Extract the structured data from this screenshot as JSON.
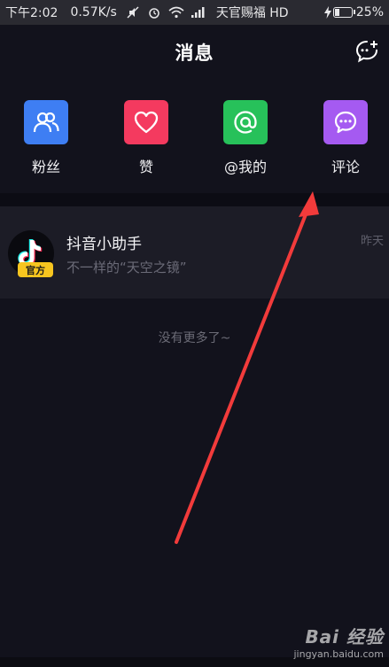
{
  "status_bar": {
    "time": "下午2:02",
    "net_speed": "0.57K/s",
    "carrier": "天官赐福 HD",
    "battery": "25%",
    "battery_level": 0.25
  },
  "header": {
    "title": "消息",
    "chat_icon": "add-chat-bubble-icon"
  },
  "categories": [
    {
      "label": "粉丝",
      "icon": "fans-icon",
      "color": "#3e7ef3"
    },
    {
      "label": "赞",
      "icon": "heart-icon",
      "color": "#f43a5f"
    },
    {
      "label": "@我的",
      "icon": "at-icon",
      "color": "#27c15a"
    },
    {
      "label": "评论",
      "icon": "comment-icon",
      "color": "#a55af1"
    }
  ],
  "messages": [
    {
      "name": "抖音小助手",
      "preview": "不一样的“天空之镜”",
      "time": "昨天",
      "badge": "官方",
      "avatar_icon": "tiktok-logo-icon"
    }
  ],
  "no_more_text": "没有更多了~",
  "watermark": {
    "logo": "Bai 经验",
    "url": "jingyan.baidu.com"
  },
  "annotation": {
    "color": "#f23b3b",
    "icon": "red-arrow-annotation"
  }
}
